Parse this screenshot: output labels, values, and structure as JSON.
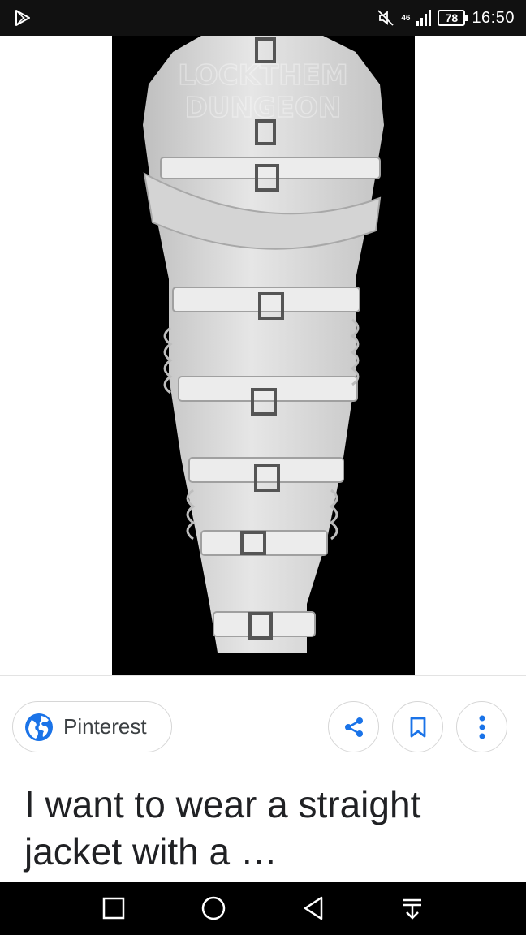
{
  "status_bar": {
    "network_type": "46",
    "battery_level": "78",
    "time": "16:50",
    "icons": [
      "play-store-icon",
      "mute-icon",
      "signal-icon",
      "battery-icon"
    ]
  },
  "image": {
    "watermark": "LOCKTHEM DUNGEON"
  },
  "source": {
    "name": "Pinterest",
    "icon": "globe-icon"
  },
  "actions": {
    "share_icon": "share-icon",
    "save_icon": "bookmark-icon",
    "more_icon": "more-vert-icon"
  },
  "result": {
    "title": "I want to wear a straight jacket with a …"
  },
  "nav_bar": {
    "icons": [
      "recents-square-icon",
      "home-circle-icon",
      "back-triangle-icon",
      "notification-pulldown-icon"
    ]
  }
}
